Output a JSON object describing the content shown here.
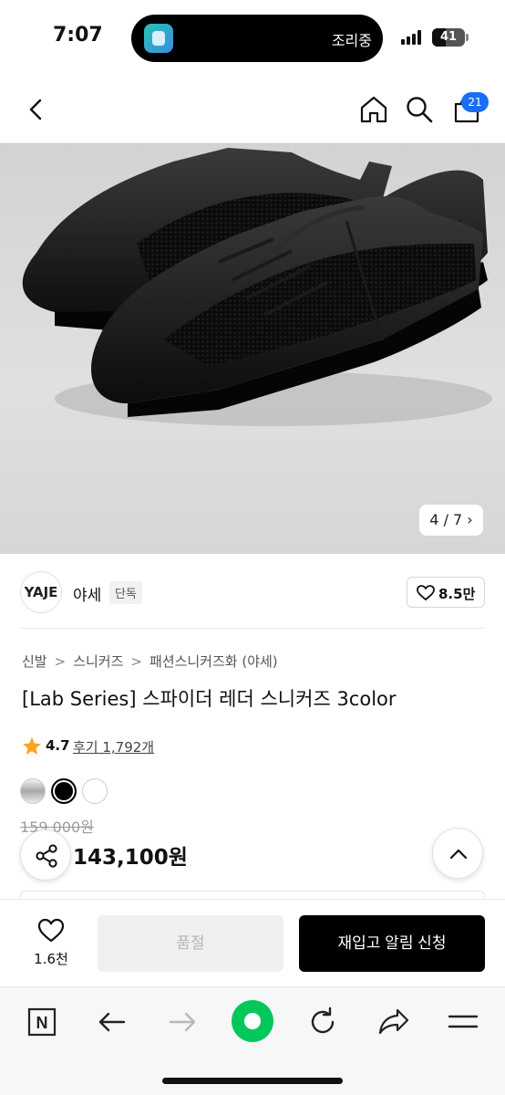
{
  "status_bar": {
    "time": "7:07",
    "island_status": "조리중",
    "battery_level": "41",
    "battery_fraction": 0.41
  },
  "header": {
    "back_icon": "chevron-left-icon",
    "home_icon": "home-icon",
    "search_icon": "search-icon",
    "cart_icon": "shopping-bag-icon",
    "cart_count": "21"
  },
  "gallery": {
    "counter": "4 / 7 ›",
    "current": 4,
    "total": 7
  },
  "store": {
    "logo_text": "YAJE",
    "name": "야세",
    "badge": "단독",
    "like_count": "8.5만"
  },
  "product": {
    "breadcrumb": [
      "신발",
      "스니커즈",
      "패션스니커즈화 (야세)"
    ],
    "breadcrumb_sep": ">",
    "title": "[Lab Series] 스파이더 레더 스니커즈 3color",
    "rating": "4.7",
    "reviews": "후기 1,792개",
    "colors": [
      "#b0b0b0",
      "#000000",
      "#ffffff"
    ],
    "original_price": "159,000원",
    "sale_price": "143,100원"
  },
  "purchase_bar": {
    "wish_count": "1.6천",
    "soldout_label": "품절",
    "restock_label": "재입고 알림 신청"
  },
  "browser": {
    "n_label": "N",
    "accent": "#03c75a"
  },
  "colors": {
    "cart_badge": "#1a6ef5",
    "star": "#f5a623"
  }
}
